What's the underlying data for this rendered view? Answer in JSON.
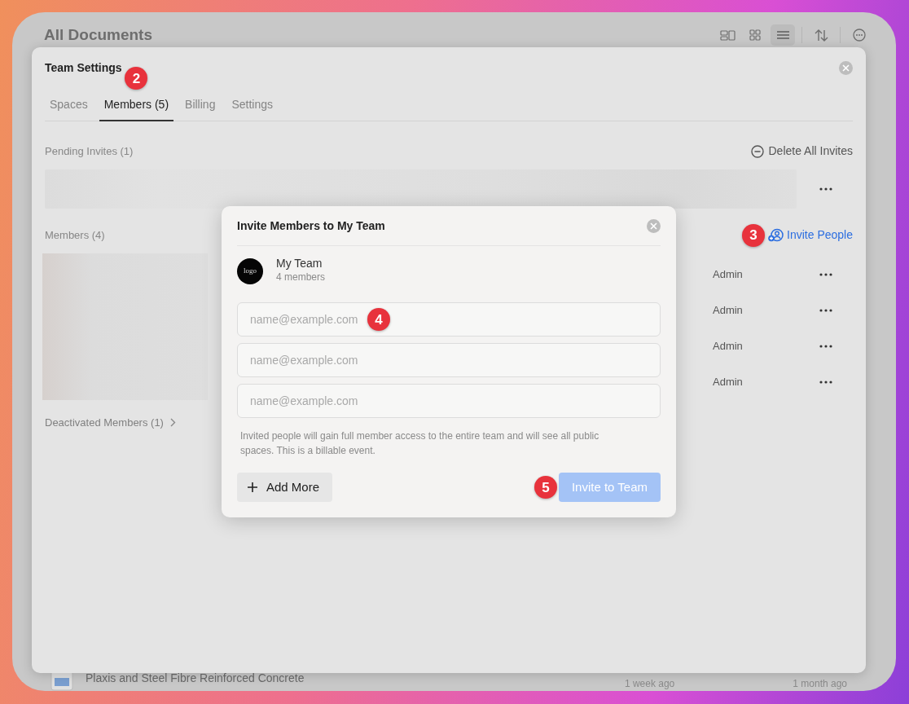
{
  "app": {
    "title": "All Documents",
    "toolbar": [
      {
        "kind": "columns",
        "selected": false
      },
      {
        "kind": "grid",
        "selected": false
      },
      {
        "kind": "list",
        "selected": true
      },
      {
        "kind": "sort",
        "selected": false
      },
      {
        "kind": "more",
        "selected": false
      }
    ],
    "document": {
      "name": "Plaxis and Steel Fibre Reinforced Concrete",
      "column_2": "1 week ago",
      "column_3": "1 month ago"
    }
  },
  "team_settings": {
    "title": "Team Settings",
    "tabs": [
      {
        "label": "Spaces",
        "selected": false
      },
      {
        "label": "Members (5)",
        "selected": true,
        "annotation": "2"
      },
      {
        "label": "Billing",
        "selected": false
      },
      {
        "label": "Settings",
        "selected": false
      }
    ],
    "pending_heading": "Pending Invites (1)",
    "delete_all": "Delete All Invites",
    "members_heading": "Members (4)",
    "invite_people": {
      "label": "Invite People",
      "annotation": "3"
    },
    "members": [
      {
        "role": "Admin"
      },
      {
        "role": "Admin"
      },
      {
        "role": "Admin"
      },
      {
        "role": "Admin"
      }
    ],
    "deactivated": "Deactivated Members (1)"
  },
  "invite_dialog": {
    "title": "Invite Members to My Team",
    "team_name": "My Team",
    "logo_text": "logo",
    "member_count": "4 members",
    "email_fields": [
      {
        "placeholder": "name@example.com",
        "annotation": "4"
      },
      {
        "placeholder": "name@example.com"
      },
      {
        "placeholder": "name@example.com"
      }
    ],
    "note": "Invited people will gain full member access to the entire team and will see all public spaces. This is a billable event.",
    "add_button": "Add More",
    "invite_button": {
      "label": "Invite to Team",
      "disabled": true,
      "annotation": "5"
    }
  }
}
